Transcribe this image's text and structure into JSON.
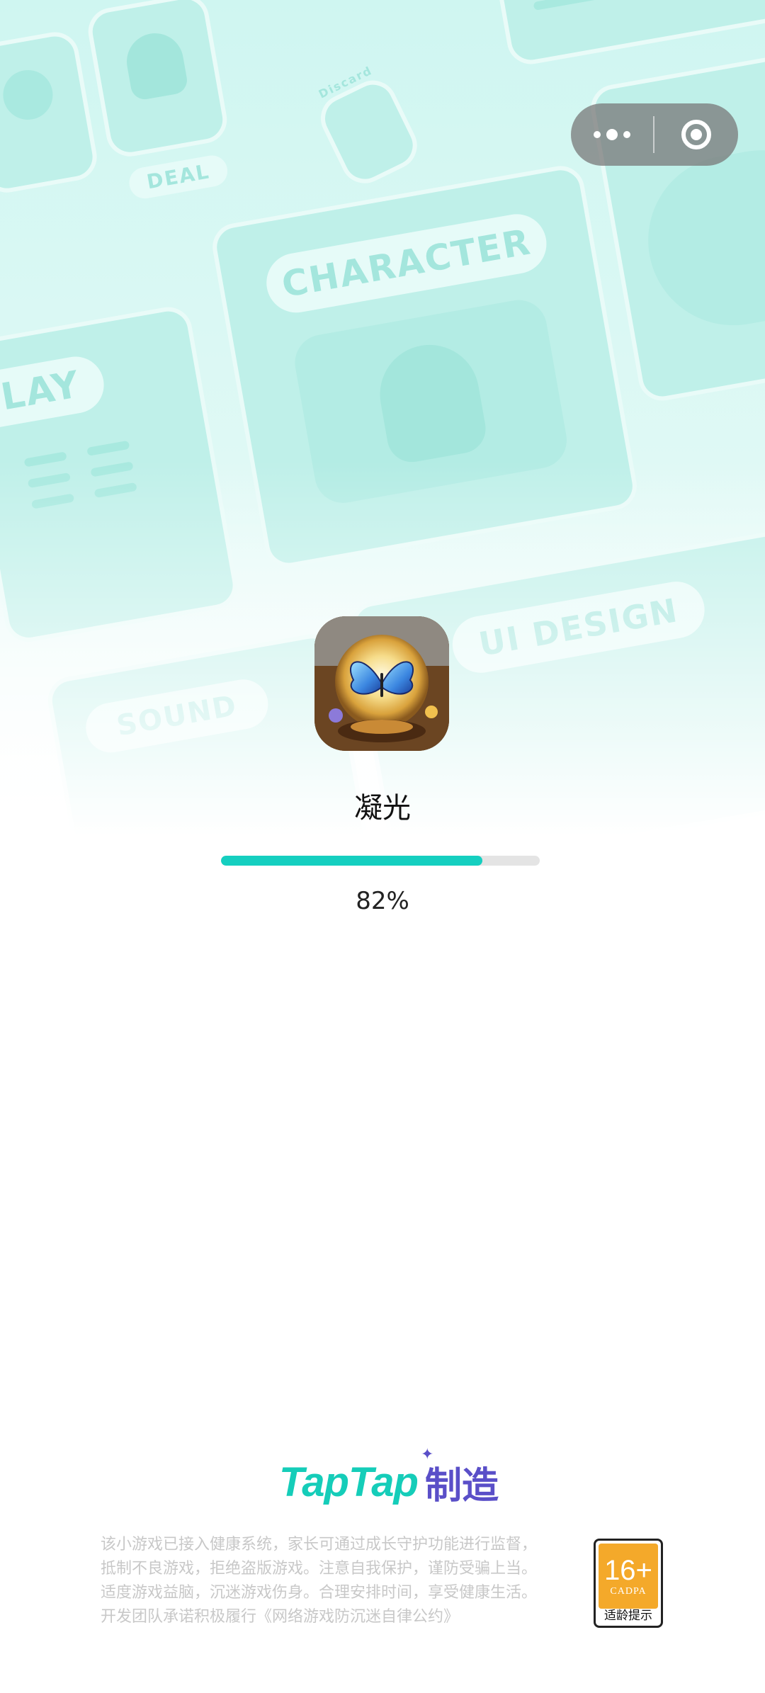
{
  "background": {
    "labels": [
      "DEAL",
      "CHARACTER",
      "PLAY",
      "UI DESIGN",
      "SOUND",
      "Discard"
    ]
  },
  "capsule": {
    "more_icon": "more-dots-icon",
    "close_icon": "close-target-icon"
  },
  "app": {
    "icon": "crystal-ball-butterfly-icon",
    "title": "凝光"
  },
  "loading": {
    "progress": 0.82,
    "progress_text": "82%"
  },
  "footer": {
    "brand_part1": "TapTap",
    "brand_part2": "制造",
    "notice_lines": [
      "该小游戏已接入健康系统，家长可通过成长守护功能进行监督，",
      "抵制不良游戏，拒绝盗版游戏。注意自我保护，谨防受骗上当。",
      "适度游戏益脑，沉迷游戏伤身。合理安排时间，享受健康生活。",
      "开发团队承诺积极履行《网络游戏防沉迷自律公约》"
    ],
    "age_rating": {
      "number": "16+",
      "org": "CADPA",
      "label": "适龄提示"
    }
  },
  "colors": {
    "accent": "#15cfc0",
    "brand_teal": "#15cdb9",
    "brand_purple": "#5a4fc8",
    "age_orange": "#f4a92a"
  }
}
